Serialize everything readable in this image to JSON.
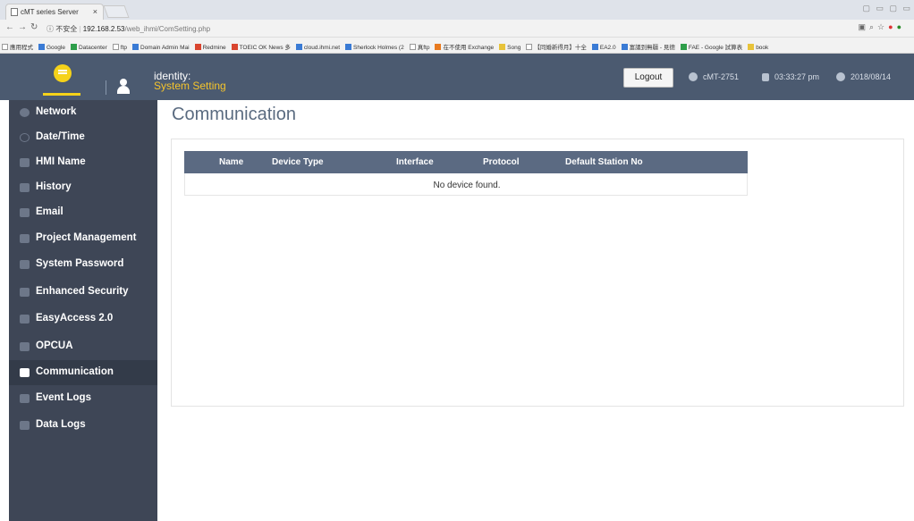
{
  "browser": {
    "tab_title": "cMT series Server",
    "tab_close": "×",
    "url_secure": "不安全",
    "url_host": "192.168.2.53",
    "url_path": "/web_ihmi/ComSetting.php",
    "bookmarks": [
      {
        "label": "應用程式",
        "color": "w"
      },
      {
        "label": "Google",
        "color": "b"
      },
      {
        "label": "Datacenter",
        "color": "g"
      },
      {
        "label": "ftp",
        "color": "w"
      },
      {
        "label": "Domain Admin Mai",
        "color": "b"
      },
      {
        "label": "Redmine",
        "color": "r"
      },
      {
        "label": "TOEIC OK News 多",
        "color": "r"
      },
      {
        "label": "cloud.ihmi.net",
        "color": "b"
      },
      {
        "label": "Sherlock Holmes (2",
        "color": "b"
      },
      {
        "label": "真ftp",
        "color": "w"
      },
      {
        "label": "在不使用 Exchange",
        "color": "o"
      },
      {
        "label": "Song",
        "color": "y"
      },
      {
        "label": "【同婚新得月】十全",
        "color": "w"
      },
      {
        "label": "EA2.0",
        "color": "b"
      },
      {
        "label": "富議到無疆 - 見德",
        "color": "b"
      },
      {
        "label": "FAE - Google 試算表",
        "color": "g"
      },
      {
        "label": "book",
        "color": "y"
      }
    ]
  },
  "header": {
    "identity_label": "identity:",
    "identity_role": "System Setting",
    "logout_label": "Logout",
    "model": "cMT-2751",
    "time": "03:33:27 pm",
    "date": "2018/08/14"
  },
  "sidebar": {
    "items": [
      {
        "label": "Network",
        "icon": "globe-icon"
      },
      {
        "label": "Date/Time",
        "icon": "clock-icon"
      },
      {
        "label": "HMI Name",
        "icon": "pencil-icon"
      },
      {
        "label": "History",
        "icon": "document-icon"
      },
      {
        "label": "Email",
        "icon": "users-icon"
      },
      {
        "label": "Project Management",
        "icon": "folder-icon"
      },
      {
        "label": "System Password",
        "icon": "lock-icon"
      },
      {
        "label": "Enhanced Security",
        "icon": "people-icon"
      },
      {
        "label": "EasyAccess 2.0",
        "icon": "plug-icon"
      },
      {
        "label": "OPCUA",
        "icon": "opcua-icon"
      },
      {
        "label": "Communication",
        "icon": "grid-icon"
      },
      {
        "label": "Event Logs",
        "icon": "event-log-icon"
      },
      {
        "label": "Data Logs",
        "icon": "data-log-icon"
      }
    ]
  },
  "main": {
    "title": "Communication",
    "table": {
      "columns": [
        "Name",
        "Device Type",
        "Interface",
        "Protocol",
        "Default Station No"
      ],
      "empty_message": "No device found."
    }
  }
}
